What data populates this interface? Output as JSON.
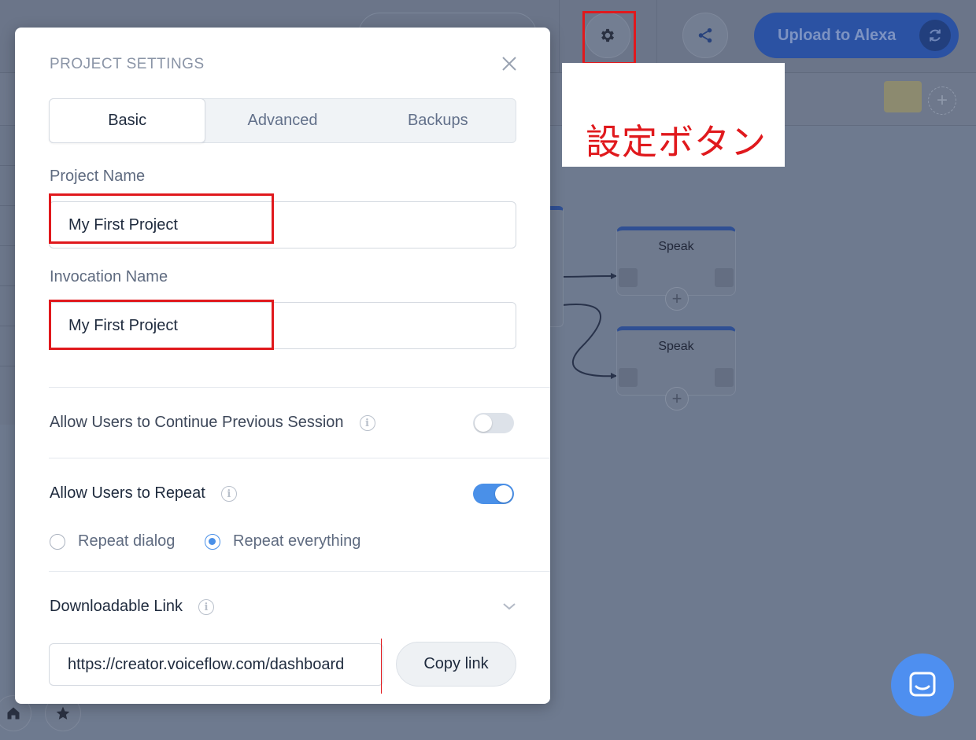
{
  "app": {
    "upload_label": "Upload to Alexa",
    "nodes": [
      {
        "title": "Speak"
      },
      {
        "title": "Speak"
      }
    ]
  },
  "annotation": {
    "label": "設定ボタン",
    "color": "#e0191d"
  },
  "modal": {
    "title": "PROJECT SETTINGS",
    "tabs": [
      {
        "label": "Basic",
        "active": true
      },
      {
        "label": "Advanced",
        "active": false
      },
      {
        "label": "Backups",
        "active": false
      }
    ],
    "project_name": {
      "label": "Project Name",
      "value": "My First Project"
    },
    "invocation_name": {
      "label": "Invocation Name",
      "value": "My First Project"
    },
    "continue_session": {
      "label": "Allow Users to Continue Previous Session",
      "enabled": false
    },
    "repeat": {
      "label": "Allow Users to Repeat",
      "enabled": true,
      "options": [
        {
          "label": "Repeat dialog",
          "selected": false
        },
        {
          "label": "Repeat everything",
          "selected": true
        }
      ]
    },
    "downloadable_link": {
      "label": "Downloadable Link",
      "value": "https://creator.voiceflow.com/dashboard",
      "copy_label": "Copy link"
    }
  },
  "colors": {
    "accent": "#4a90e8",
    "upload_button": "#2b52a3",
    "chat_button": "#4e8ff0"
  }
}
